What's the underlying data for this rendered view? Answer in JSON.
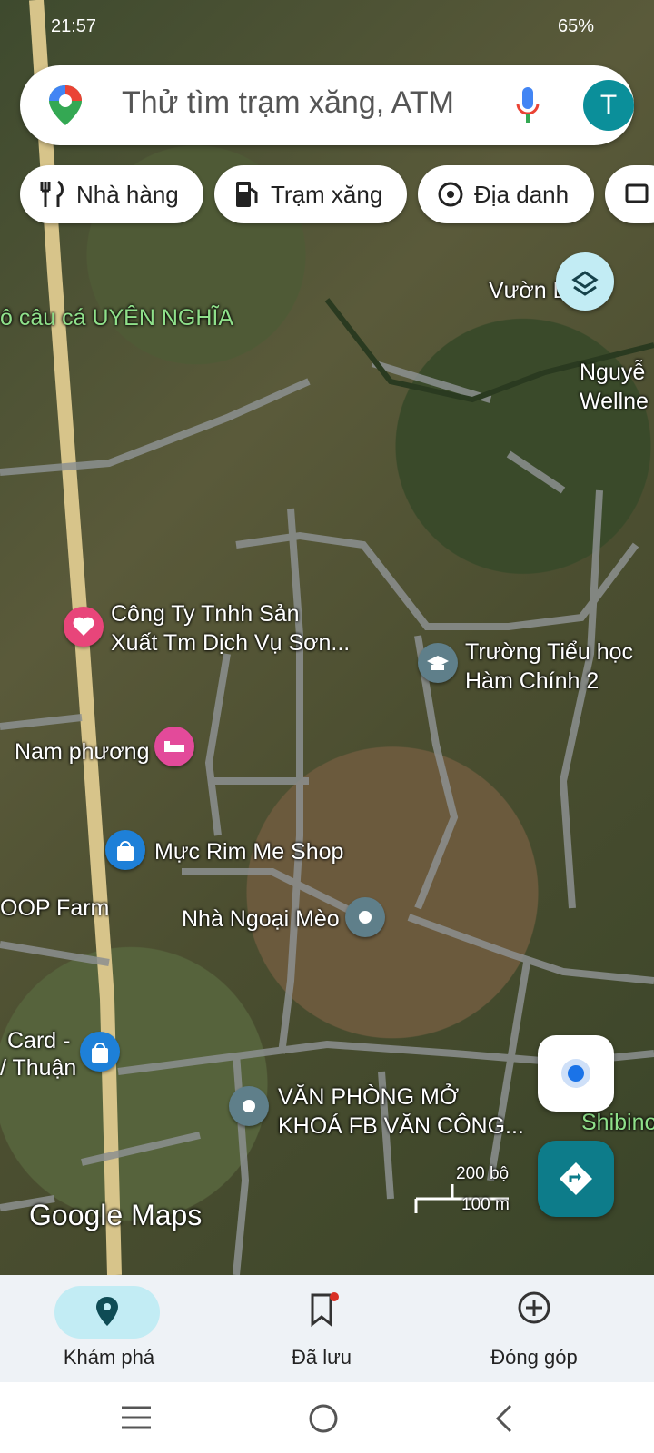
{
  "status_bar": {
    "time": "21:57",
    "battery": "65%"
  },
  "search": {
    "placeholder": "Thử tìm trạm xăng, ATM",
    "avatar_letter": "T"
  },
  "chips": [
    {
      "label": "Nhà hàng",
      "icon": "restaurant-icon"
    },
    {
      "label": "Trạm xăng",
      "icon": "gas-station-icon"
    },
    {
      "label": "Địa danh",
      "icon": "landmark-icon"
    }
  ],
  "map_labels": {
    "vuon": "Vườn L a L",
    "cau_ca": "ô câu cá UYÊN NGHĨA",
    "nguyen": "Nguyễ",
    "wellness": "Wellne",
    "cong_ty_1": "Công Ty Tnhh Sản",
    "cong_ty_2": "Xuất Tm Dịch Vụ Sơn...",
    "truong_1": "Trường Tiểu học",
    "truong_2": "Hàm Chính 2",
    "nam_phuong": "Nam phương",
    "muc_rim": "Mực Rim Me Shop",
    "loop_farm": "OOP Farm",
    "nha_ngoai": "Nhà Ngoại Mèo",
    "card_1": "Card -",
    "card_2": "/ Thuận",
    "van_phong_1": "VĂN PHÒNG MỞ",
    "van_phong_2": "KHOÁ FB VĂN CÔNG...",
    "shibino": "Shibino",
    "scale_ft": "200 bộ",
    "scale_m": "100 m",
    "brand": "Google Maps"
  },
  "bottom_nav": [
    {
      "label": "Khám phá",
      "icon": "explore-pin-icon",
      "active": true
    },
    {
      "label": "Đã lưu",
      "icon": "bookmark-icon",
      "badge": true
    },
    {
      "label": "Đóng góp",
      "icon": "add-circle-icon"
    }
  ],
  "colors": {
    "accent": "#0b8f9a",
    "active_pill": "#c2ecf4",
    "teal_fab": "#0d7c8a",
    "location_dot": "#1a73e8"
  }
}
